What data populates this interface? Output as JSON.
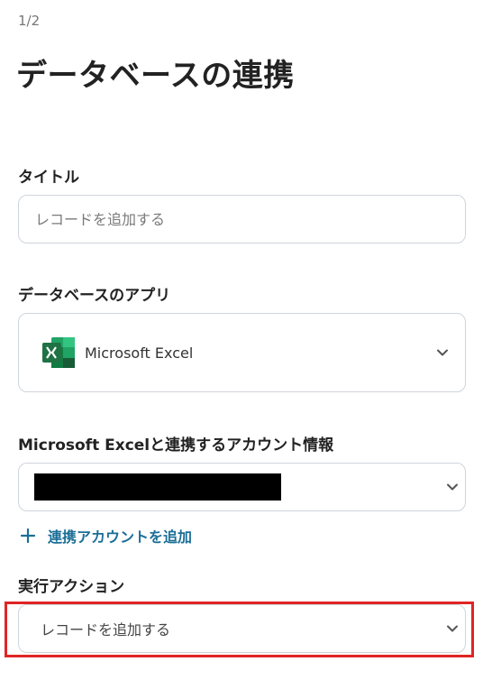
{
  "header": {
    "step": "1/2",
    "title": "データベースの連携"
  },
  "form": {
    "title_field": {
      "label": "タイトル",
      "value": "",
      "placeholder": "レコードを追加する"
    },
    "app_field": {
      "label": "データベースのアプリ",
      "value": "Microsoft Excel",
      "icon": "excel-icon"
    },
    "account_field": {
      "label": "Microsoft Excelと連携するアカウント情報",
      "value": "",
      "icon": "chevron-down-icon"
    },
    "add_account": {
      "label": "連携アカウントを追加",
      "icon": "plus-icon"
    },
    "action_field": {
      "label": "実行アクション",
      "value": "レコードを追加する",
      "icon": "chevron-down-icon",
      "highlight_color": "#e02424"
    }
  },
  "colors": {
    "accent_link": "#1b6f97",
    "border": "#cfd5dc",
    "excel_green": "#1f7244",
    "highlight": "#e02424"
  }
}
